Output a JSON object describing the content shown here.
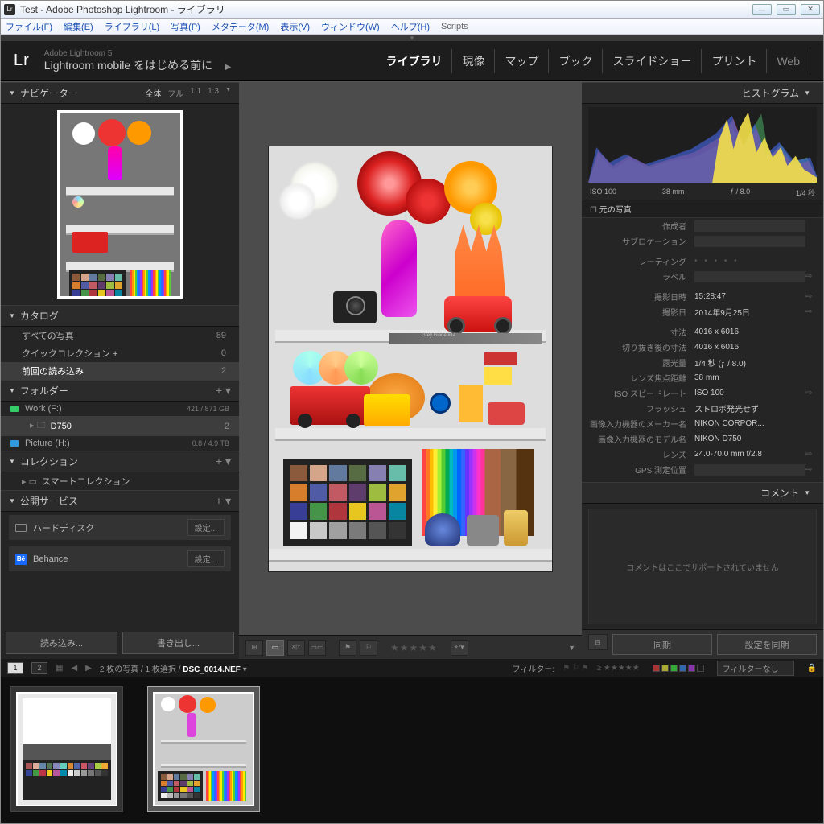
{
  "window": {
    "title": "Test - Adobe Photoshop Lightroom - ライブラリ"
  },
  "menubar": [
    "ファイル(F)",
    "編集(E)",
    "ライブラリ(L)",
    "写真(P)",
    "メタデータ(M)",
    "表示(V)",
    "ウィンドウ(W)",
    "ヘルプ(H)",
    "Scripts"
  ],
  "identity": {
    "logo": "Lr",
    "product": "Adobe Lightroom 5",
    "mobile": "Lightroom mobile をはじめる前に",
    "play": "▶"
  },
  "modules": [
    "ライブラリ",
    "現像",
    "マップ",
    "ブック",
    "スライドショー",
    "プリント",
    "Web"
  ],
  "left": {
    "navigator": {
      "title": "ナビゲーター",
      "modes": [
        "全体",
        "フル",
        "1:1",
        "1:3"
      ]
    },
    "catalog": {
      "title": "カタログ",
      "items": [
        {
          "label": "すべての写真",
          "count": "89"
        },
        {
          "label": "クイックコレクション  +",
          "count": "0"
        },
        {
          "label": "前回の読み込み",
          "count": "2",
          "selected": true
        }
      ]
    },
    "folders": {
      "title": "フォルダー",
      "volumes": [
        {
          "name": "Work (F:)",
          "stat": "421 / 871 GB",
          "sub": [
            {
              "name": "D750",
              "count": "2",
              "selected": true
            }
          ]
        },
        {
          "name": "Picture (H:)",
          "stat": "0.8 / 4.9 TB"
        }
      ]
    },
    "collections": {
      "title": "コレクション",
      "smart": "スマートコレクション"
    },
    "publish": {
      "title": "公開サービス",
      "items": [
        {
          "icon": "hd",
          "label": "ハードディスク",
          "btn": "設定..."
        },
        {
          "icon": "be",
          "label": "Behance",
          "btn": "設定..."
        }
      ]
    },
    "buttons": {
      "import": "読み込み...",
      "export": "書き出し..."
    }
  },
  "right": {
    "histogram": {
      "title": "ヒストグラム",
      "labels": {
        "iso": "ISO 100",
        "focal": "38 mm",
        "aperture": "ƒ / 8.0",
        "shutter": "1/4 秒"
      }
    },
    "original": "元の写真",
    "metadata": [
      {
        "label": "作成者",
        "value": ""
      },
      {
        "label": "サブロケーション",
        "value": ""
      },
      {
        "label": "レーティング",
        "value": "",
        "rating": true
      },
      {
        "label": "ラベル",
        "value": "",
        "arrow": true
      },
      {
        "label": "撮影日時",
        "value": "15:28:47",
        "arrow": true
      },
      {
        "label": "撮影日",
        "value": "2014年9月25日",
        "arrow": true
      },
      {
        "label": "寸法",
        "value": "4016 x 6016"
      },
      {
        "label": "切り抜き後の寸法",
        "value": "4016 x 6016"
      },
      {
        "label": "露光量",
        "value": "1/4 秒 (ƒ / 8.0)"
      },
      {
        "label": "レンズ焦点距離",
        "value": "38 mm"
      },
      {
        "label": "ISO スピードレート",
        "value": "ISO 100",
        "arrow": true
      },
      {
        "label": "フラッシュ",
        "value": "ストロボ発光せず"
      },
      {
        "label": "画像入力機器のメーカー名",
        "value": "NIKON CORPOR..."
      },
      {
        "label": "画像入力機器のモデル名",
        "value": "NIKON D750"
      },
      {
        "label": "レンズ",
        "value": "24.0-70.0 mm f/2.8",
        "arrow": true
      },
      {
        "label": "GPS 測定位置",
        "value": "",
        "arrow": true
      }
    ],
    "comments": {
      "title": "コメント",
      "placeholder": "コメントはここでサポートされていません"
    },
    "sync": {
      "btn1": "同期",
      "btn2": "設定を同期"
    }
  },
  "filmstrip": {
    "tabs": [
      "1",
      "2"
    ],
    "path_prefix": "2 枚の写真 / 1 枚選択 / ",
    "filename": "DSC_0014.NEF",
    "filter_label": "フィルター:",
    "filter_none": "フィルターなし"
  }
}
